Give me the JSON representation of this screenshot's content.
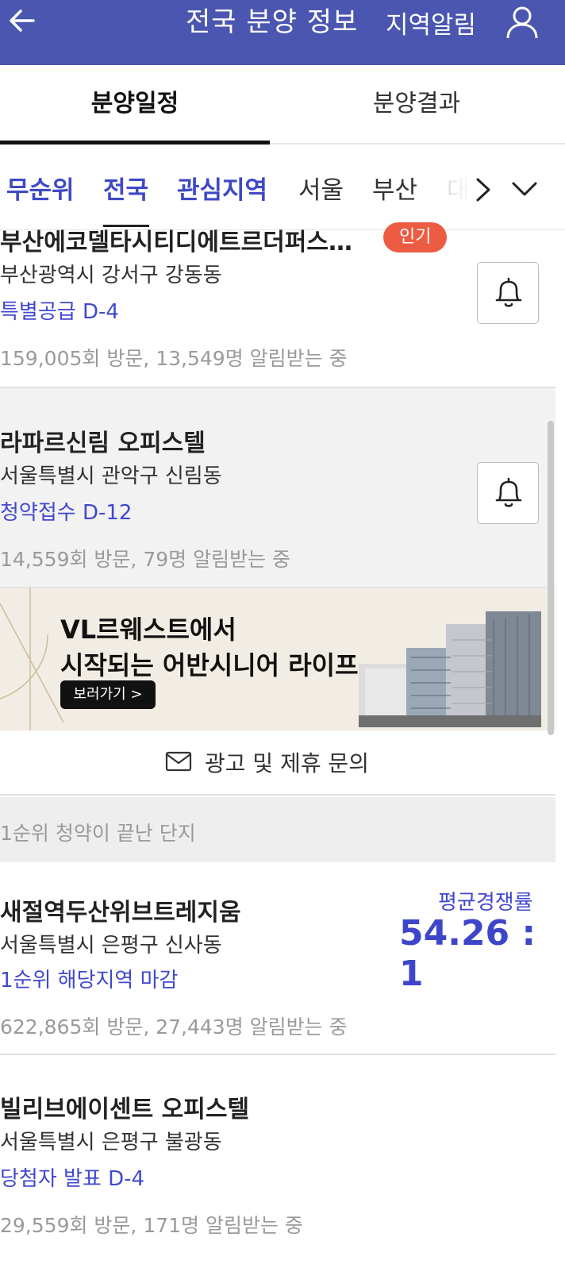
{
  "header": {
    "title": "전국 분양 정보",
    "region_alert": "지역알림",
    "bg_color": "#4a56b0"
  },
  "tabs": [
    {
      "label": "분양일정",
      "active": true
    },
    {
      "label": "분양결과",
      "active": false
    }
  ],
  "filters": [
    {
      "label": "무순위",
      "style": "blue"
    },
    {
      "label": "전국",
      "style": "blue",
      "selected": true
    },
    {
      "label": "관심지역",
      "style": "blue"
    },
    {
      "label": "서울",
      "style": "gray"
    },
    {
      "label": "부산",
      "style": "gray"
    },
    {
      "label": "대",
      "style": "fade"
    }
  ],
  "cards": [
    {
      "name": "부산에코델타시티디에트르더퍼스…",
      "badge": "인기",
      "address": "부산광역시 강서구 강동동",
      "status": "특별공급  D-4",
      "stats": "159,005회 방문, 13,549명 알림받는 중"
    },
    {
      "name": "라파르신림 오피스텔",
      "address": "서울특별시 관악구 신림동",
      "status": "청약접수  D-12",
      "stats": "14,559회 방문, 79명 알림받는 중"
    }
  ],
  "ad": {
    "line1": "VL르웨스트에서",
    "line2": "시작되는 어반시니어 라이프",
    "button": "보러가기 >"
  },
  "inquiry": "광고 및 제휴 문의",
  "section_title": "1순위 청약이 끝난 단지",
  "results": [
    {
      "name": "새절역두산위브트레지움",
      "address": "서울특별시 은평구 신사동",
      "status": "1순위 해당지역 마감",
      "stats": "622,865회 방문, 27,443명 알림받는 중",
      "ratio_label": "평균경쟁률",
      "ratio_value": "54.26 : 1"
    },
    {
      "name": "빌리브에이센트 오피스텔",
      "address": "서울특별시 은평구 불광동",
      "status": "당첨자 발표  D-4",
      "stats": "29,559회 방문, 171명 알림받는 중"
    }
  ]
}
